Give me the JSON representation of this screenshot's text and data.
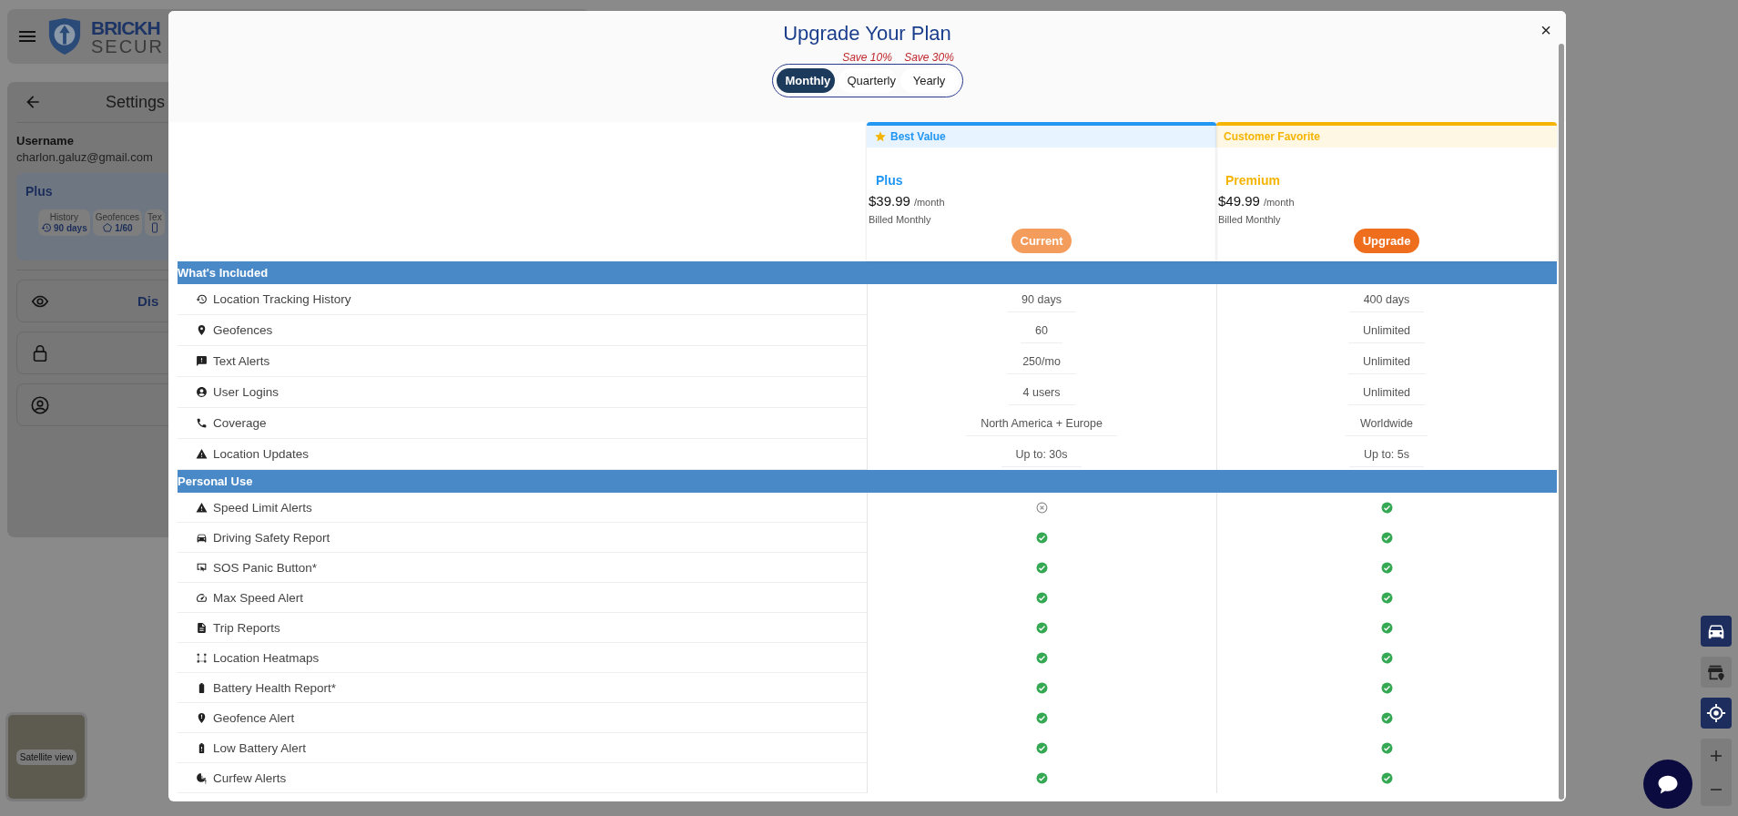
{
  "app_header": {
    "logo_line_1": "BRICKH",
    "logo_line_2": "SECUR"
  },
  "settings_panel": {
    "title": "Settings",
    "username_label": "Username",
    "username": "charlon.galuz@gmail.com",
    "plan_name": "Plus",
    "stats": [
      {
        "label": "History",
        "value": "90 days"
      },
      {
        "label": "Geofences",
        "value": "1/60"
      },
      {
        "label": "Tex"
      }
    ],
    "option_rows": [
      {
        "label": "Dis"
      },
      {},
      {}
    ]
  },
  "map": {
    "satellite_button": "Satellite view"
  },
  "modal": {
    "title": "Upgrade Your Plan",
    "close": "×",
    "billing_options": [
      {
        "label": "Monthly",
        "selected": true
      },
      {
        "label": "Quarterly",
        "discount": "Save 10%",
        "selected": false
      },
      {
        "label": "Yearly",
        "discount": "Save 30%",
        "selected": false
      }
    ],
    "plans": [
      {
        "badge": "Best Value",
        "badge_star": true,
        "name": "Plus",
        "price": "$39.99",
        "period": "/month",
        "billing": "Billed Monthly",
        "button": "Current",
        "current": true,
        "color": "#2196f3"
      },
      {
        "badge": "Customer Favorite",
        "badge_star": false,
        "name": "Premium",
        "price": "$49.99",
        "period": "/month",
        "billing": "Billed Monthly",
        "button": "Upgrade",
        "current": false,
        "color": "#f5b400"
      }
    ],
    "sections": [
      {
        "title": "What's Included",
        "rows": [
          {
            "label": "Location Tracking History",
            "kind": "value",
            "values": [
              "90 days",
              "400 days"
            ]
          },
          {
            "label": "Geofences",
            "kind": "value",
            "values": [
              "60",
              "Unlimited"
            ]
          },
          {
            "label": "Text Alerts",
            "kind": "value",
            "values": [
              "250/mo",
              "Unlimited"
            ]
          },
          {
            "label": "User Logins",
            "kind": "value",
            "values": [
              "4 users",
              "Unlimited"
            ]
          },
          {
            "label": "Coverage",
            "kind": "value",
            "values": [
              "North America + Europe",
              "Worldwide"
            ]
          },
          {
            "label": "Location Updates",
            "kind": "value",
            "values": [
              "Up to: 30s",
              "Up to: 5s"
            ]
          }
        ]
      },
      {
        "title": "Personal Use",
        "rows": [
          {
            "label": "Speed Limit Alerts",
            "kind": "check",
            "included": [
              false,
              true
            ]
          },
          {
            "label": "Driving Safety Report",
            "kind": "check",
            "included": [
              true,
              true
            ]
          },
          {
            "label": "SOS Panic Button*",
            "kind": "check",
            "included": [
              true,
              true
            ]
          },
          {
            "label": "Max Speed Alert",
            "kind": "check",
            "included": [
              true,
              true
            ]
          },
          {
            "label": "Trip Reports",
            "kind": "check",
            "included": [
              true,
              true
            ]
          },
          {
            "label": "Location Heatmaps",
            "kind": "check",
            "included": [
              true,
              true
            ]
          },
          {
            "label": "Battery Health Report*",
            "kind": "check",
            "included": [
              true,
              true
            ]
          },
          {
            "label": "Geofence Alert",
            "kind": "check",
            "included": [
              true,
              true
            ]
          },
          {
            "label": "Low Battery Alert",
            "kind": "check",
            "included": [
              true,
              true
            ]
          },
          {
            "label": "Curfew Alerts",
            "kind": "check",
            "included": [
              true,
              true
            ]
          }
        ]
      }
    ]
  }
}
